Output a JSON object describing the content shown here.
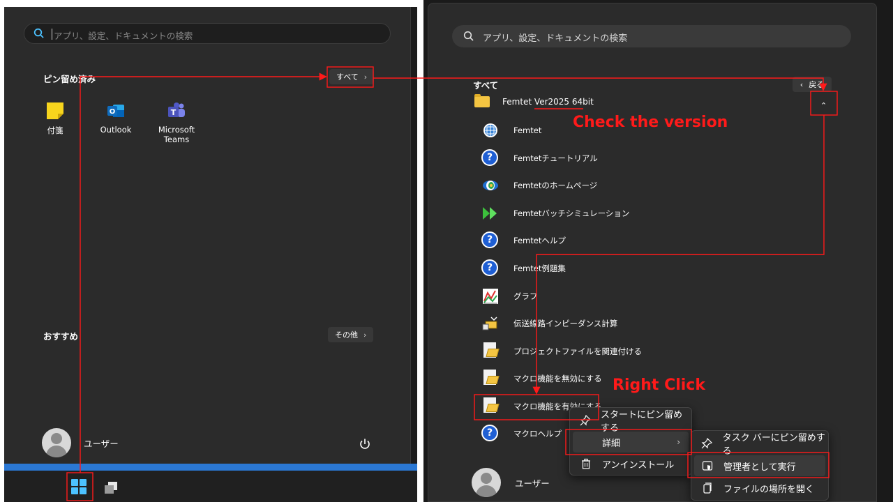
{
  "left": {
    "search": {
      "placeholder": "アプリ、設定、ドキュメントの検索"
    },
    "pinned": {
      "title": "ピン留め済み",
      "all_button": "すべて",
      "apps": [
        {
          "label": "付箋",
          "icon": "sticky-notes-icon"
        },
        {
          "label": "Outlook",
          "icon": "outlook-icon"
        },
        {
          "label": "Microsoft Teams",
          "icon": "teams-icon"
        }
      ]
    },
    "recommended": {
      "title": "おすすめ",
      "more_button": "その他"
    },
    "user": {
      "name": "ユーザー"
    },
    "colors": {
      "accent": "#4cc2ff",
      "taskbar_strip": "#2b78d4"
    }
  },
  "right": {
    "search": {
      "placeholder": "アプリ、設定、ドキュメントの検索"
    },
    "all_apps_title": "すべて",
    "back_button": "戻る",
    "folder": {
      "name": "Femtet Ver2025 64bit"
    },
    "apps": [
      {
        "label": "Femtet",
        "icon": "femtet-icon"
      },
      {
        "label": "Femtetチュートリアル",
        "icon": "help-icon"
      },
      {
        "label": "Femtetのホームページ",
        "icon": "globe-icon"
      },
      {
        "label": "Femtetバッチシミュレーション",
        "icon": "batch-icon"
      },
      {
        "label": "Femtetヘルプ",
        "icon": "help-icon"
      },
      {
        "label": "Femtet例題集",
        "icon": "help-icon"
      },
      {
        "label": "グラフ",
        "icon": "graph-icon"
      },
      {
        "label": "伝送線路インピーダンス計算",
        "icon": "calculator-icon"
      },
      {
        "label": "プロジェクトファイルを関連付ける",
        "icon": "script-icon"
      },
      {
        "label": "マクロ機能を無効にする",
        "icon": "script-icon"
      },
      {
        "label": "マクロ機能を有効にする",
        "icon": "script-icon"
      },
      {
        "label": "マクロヘルプ",
        "icon": "help-icon"
      }
    ],
    "user": {
      "name": "ユーザー"
    }
  },
  "context_menu": {
    "items": [
      "スタートにピン留めする",
      "詳細",
      "アンインストール"
    ]
  },
  "submenu": {
    "items": [
      "タスク バーにピン留めする",
      "管理者として実行",
      "ファイルの場所を開く"
    ]
  },
  "annotations": {
    "check_version": "Check the version",
    "right_click": "Right Click",
    "color": "#ff1a1a"
  }
}
